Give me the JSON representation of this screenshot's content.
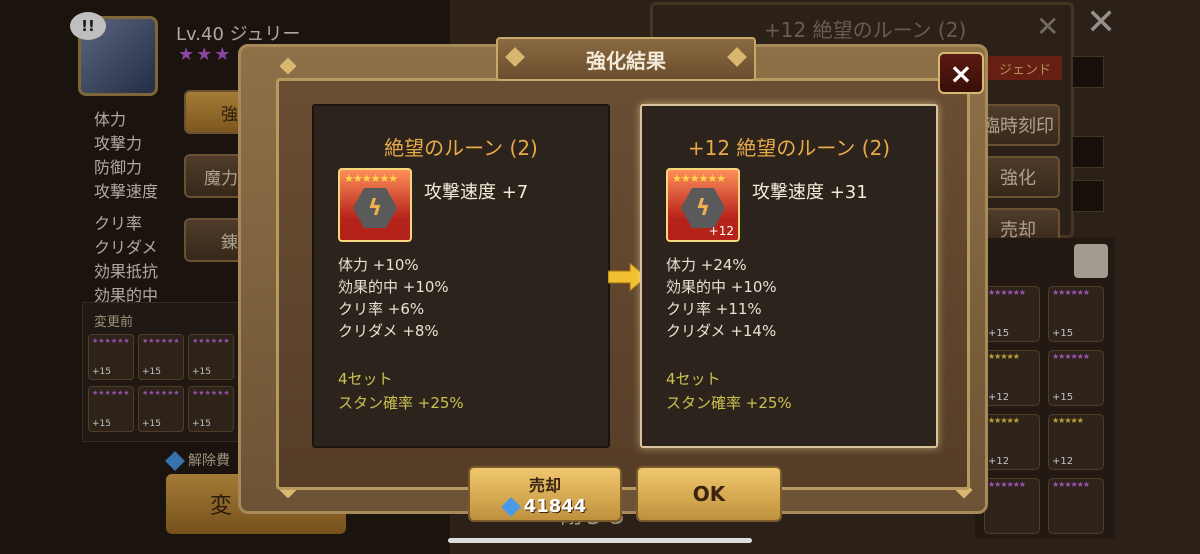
{
  "background": {
    "alert_icon": "!!",
    "level_name": "Lv.40 ジュリー",
    "stars": "★★★",
    "stats": [
      "体力",
      "攻撃力",
      "防御力",
      "攻撃速度",
      "クリ率",
      "クリダメ",
      "効果抵抗",
      "効果的中"
    ],
    "side_tabs": [
      "強化",
      "魔力刻印",
      "錬成"
    ],
    "change_before_label": "変更前",
    "mini_runes": [
      "+15",
      "+15",
      "+15",
      "+15",
      "+15",
      "+15"
    ],
    "mini_rune_grade": "E",
    "release_cost_label": "解除費",
    "change_button": "変",
    "right_window_title": "+12 絶望のルーン (2)",
    "legend_tag": "ジェンド",
    "right_buttons": [
      "臨時刻印",
      "強化",
      "売却"
    ],
    "right_grid_levels": [
      "+15",
      "+15",
      "+12",
      "+15",
      "+12",
      "+12"
    ],
    "close_label": "閉じる"
  },
  "dialog": {
    "title": "強化結果",
    "close_icon": "×",
    "before": {
      "title": "絶望のルーン (2)",
      "main_stat": "攻撃速度 +7",
      "rune_level": "",
      "substats": [
        "体力 +10%",
        "効果的中 +10%",
        "クリ率 +6%",
        "クリダメ +8%"
      ],
      "set_count": "4セット",
      "set_effect": "スタン確率 +25%"
    },
    "after": {
      "title": "+12 絶望のルーン (2)",
      "main_stat": "攻撃速度 +31",
      "rune_level": "+12",
      "substats": [
        "体力 +24%",
        "効果的中 +10%",
        "クリ率 +11%",
        "クリダメ +14%"
      ],
      "set_count": "4セット",
      "set_effect": "スタン確率 +25%"
    },
    "sell_button": {
      "label": "売却",
      "price": "41844"
    },
    "ok_button": "OK"
  },
  "colors": {
    "accent": "#e8a94a",
    "set_text": "#c9c050",
    "gold_button": "#f0c870",
    "gem": "#4a9ae8"
  }
}
